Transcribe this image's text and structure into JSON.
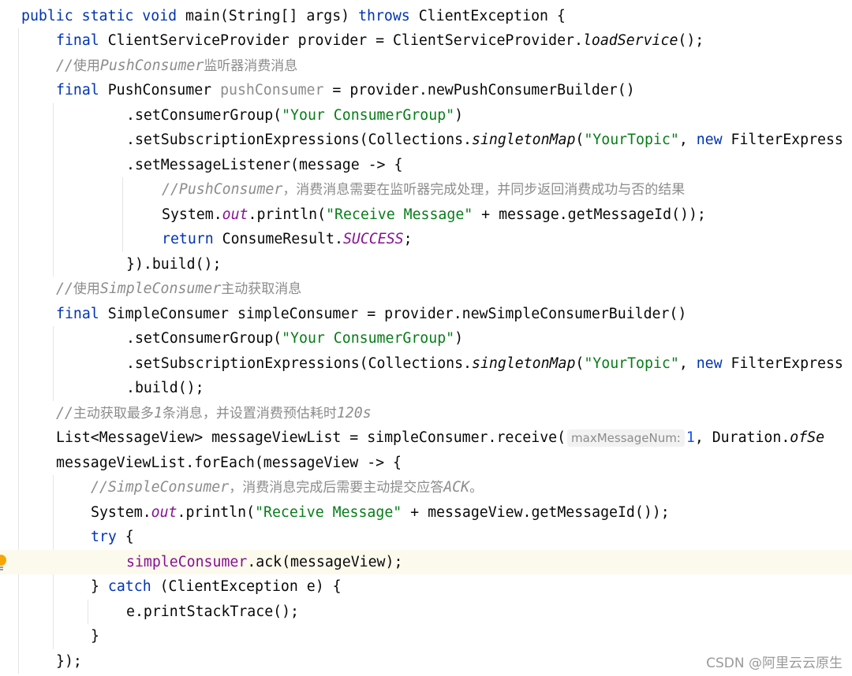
{
  "editor": {
    "language": "java",
    "highlighted_line": 23,
    "lines": [
      {
        "indent": 0,
        "tokens": [
          [
            "kw",
            "public static void "
          ],
          [
            "fn",
            "main"
          ],
          [
            "",
            "(String[] args) "
          ],
          [
            "kw",
            "throws"
          ],
          [
            "",
            " ClientException {"
          ]
        ]
      },
      {
        "indent": 1,
        "tokens": [
          [
            "kw",
            "final"
          ],
          [
            "",
            " ClientServiceProvider provider = ClientServiceProvider."
          ],
          [
            "it",
            "loadService"
          ],
          [
            "",
            "();"
          ]
        ]
      },
      {
        "indent": 1,
        "tokens": [
          [
            "cmt",
            "//"
          ],
          [
            "cmt-cn",
            "使用"
          ],
          [
            "cmt",
            "PushConsumer"
          ],
          [
            "cmt-cn",
            "监听器消费消息"
          ]
        ]
      },
      {
        "indent": 1,
        "tokens": [
          [
            "kw",
            "final"
          ],
          [
            "",
            " PushConsumer "
          ],
          [
            "unused",
            "pushConsumer"
          ],
          [
            "",
            " = provider.newPushConsumerBuilder()"
          ]
        ]
      },
      {
        "indent": 3,
        "tokens": [
          [
            "",
            ".setConsumerGroup("
          ],
          [
            "str",
            "\"Your ConsumerGroup\""
          ],
          [
            "",
            ")"
          ]
        ]
      },
      {
        "indent": 3,
        "tokens": [
          [
            "",
            ".setSubscriptionExpressions(Collections."
          ],
          [
            "it",
            "singletonMap"
          ],
          [
            "",
            "("
          ],
          [
            "str",
            "\"YourTopic\""
          ],
          [
            "",
            ", "
          ],
          [
            "kw",
            "new"
          ],
          [
            "",
            " FilterExpress"
          ]
        ]
      },
      {
        "indent": 3,
        "tokens": [
          [
            "",
            ".setMessageListener(message -> {"
          ]
        ]
      },
      {
        "indent": 4,
        "tokens": [
          [
            "cmt",
            "//PushConsumer"
          ],
          [
            "cmt-cn",
            "，消费消息需要在监听器完成处理，并同步返回消费成功与否的结果"
          ]
        ]
      },
      {
        "indent": 4,
        "tokens": [
          [
            "",
            "System."
          ],
          [
            "fld",
            "out"
          ],
          [
            "",
            ".println("
          ],
          [
            "str",
            "\"Receive Message\""
          ],
          [
            "",
            " + message.getMessageId());"
          ]
        ]
      },
      {
        "indent": 4,
        "tokens": [
          [
            "kw",
            "return"
          ],
          [
            "",
            " ConsumeResult."
          ],
          [
            "fld",
            "SUCCESS"
          ],
          [
            "",
            ";"
          ]
        ]
      },
      {
        "indent": 3,
        "tokens": [
          [
            "",
            "}).build();"
          ]
        ]
      },
      {
        "indent": 1,
        "tokens": [
          [
            "cmt",
            "//"
          ],
          [
            "cmt-cn",
            "使用"
          ],
          [
            "cmt",
            "SimpleConsumer"
          ],
          [
            "cmt-cn",
            "主动获取消息"
          ]
        ]
      },
      {
        "indent": 1,
        "tokens": [
          [
            "kw",
            "final"
          ],
          [
            "",
            " SimpleConsumer simpleConsumer = provider.newSimpleConsumerBuilder()"
          ]
        ]
      },
      {
        "indent": 3,
        "tokens": [
          [
            "",
            ".setConsumerGroup("
          ],
          [
            "str",
            "\"Your ConsumerGroup\""
          ],
          [
            "",
            ")"
          ]
        ]
      },
      {
        "indent": 3,
        "tokens": [
          [
            "",
            ".setSubscriptionExpressions(Collections."
          ],
          [
            "it",
            "singletonMap"
          ],
          [
            "",
            "("
          ],
          [
            "str",
            "\"YourTopic\""
          ],
          [
            "",
            ", "
          ],
          [
            "kw",
            "new"
          ],
          [
            "",
            " FilterExpress"
          ]
        ]
      },
      {
        "indent": 3,
        "tokens": [
          [
            "",
            ".build();"
          ]
        ]
      },
      {
        "indent": 1,
        "tokens": [
          [
            "cmt",
            "//"
          ],
          [
            "cmt-cn",
            "主动获取最多"
          ],
          [
            "cmt",
            "1"
          ],
          [
            "cmt-cn",
            "条消息，并设置消费预估耗时"
          ],
          [
            "cmt",
            "120s"
          ]
        ]
      },
      {
        "indent": 1,
        "tokens": [
          [
            "",
            "List<MessageView> messageViewList = simpleConsumer.receive("
          ],
          [
            "hint",
            "maxMessageNum:"
          ],
          [
            "num",
            "1"
          ],
          [
            "",
            ", Duration."
          ],
          [
            "it",
            "ofSe"
          ]
        ]
      },
      {
        "indent": 1,
        "tokens": [
          [
            "",
            "messageViewList.forEach(messageView -> {"
          ]
        ]
      },
      {
        "indent": 2,
        "tokens": [
          [
            "cmt",
            "//SimpleConsumer"
          ],
          [
            "cmt-cn",
            "，消费消息完成后需要主动提交应答"
          ],
          [
            "cmt",
            "ACK"
          ],
          [
            "cmt-cn",
            "。"
          ]
        ]
      },
      {
        "indent": 2,
        "tokens": [
          [
            "",
            "System."
          ],
          [
            "fld",
            "out"
          ],
          [
            "",
            ".println("
          ],
          [
            "str",
            "\"Receive Message\""
          ],
          [
            "",
            " + messageView.getMessageId());"
          ]
        ]
      },
      {
        "indent": 2,
        "tokens": [
          [
            "kw",
            "try"
          ],
          [
            "",
            " {"
          ]
        ]
      },
      {
        "indent": 3,
        "tokens": [
          [
            "var",
            "simpleConsumer"
          ],
          [
            "",
            ".ack(messageView);"
          ]
        ]
      },
      {
        "indent": 2,
        "tokens": [
          [
            "",
            "} "
          ],
          [
            "kw",
            "catch"
          ],
          [
            "",
            " (ClientException e) {"
          ]
        ]
      },
      {
        "indent": 3,
        "tokens": [
          [
            "",
            "e.printStackTrace();"
          ]
        ]
      },
      {
        "indent": 2,
        "tokens": [
          [
            "",
            "}"
          ]
        ]
      },
      {
        "indent": 1,
        "tokens": [
          [
            "",
            "});"
          ]
        ]
      }
    ]
  },
  "gutter": {
    "intention_icon": "lightbulb-icon",
    "intention_line": 23
  },
  "watermark": "CSDN @阿里云云原生"
}
